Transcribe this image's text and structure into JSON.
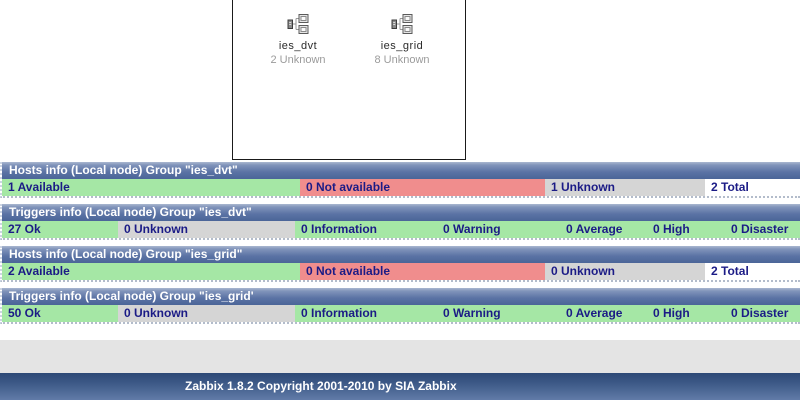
{
  "map": {
    "hosts": [
      {
        "name": "ies_dvt",
        "status": "2 Unknown",
        "icon": "host-group-icon"
      },
      {
        "name": "ies_grid",
        "status": "8 Unknown",
        "icon": "host-group-icon"
      }
    ]
  },
  "widgets": [
    {
      "title": "Hosts info (Local node) Group \"ies_dvt\"",
      "cells": [
        "1 Available",
        "0 Not available",
        "1 Unknown",
        "2 Total"
      ]
    },
    {
      "title": "Triggers info (Local node) Group \"ies_dvt\"",
      "cells": [
        "27 Ok",
        "0 Unknown",
        "0 Information",
        "0 Warning",
        "0 Average",
        "0 High",
        "0 Disaster"
      ]
    },
    {
      "title": "Hosts info (Local node) Group \"ies_grid\"",
      "cells": [
        "2 Available",
        "0 Not available",
        "0 Unknown",
        "2 Total"
      ]
    },
    {
      "title": "Triggers info (Local node) Group \"ies_grid'",
      "cells": [
        "50 Ok",
        "0 Unknown",
        "0 Information",
        "0 Warning",
        "0 Average",
        "0 High",
        "0 Disaster"
      ]
    }
  ],
  "footer": {
    "text": "Zabbix 1.8.2 Copyright 2001-2010 by SIA Zabbix"
  },
  "colors": {
    "header_blue_top": "#aab7d0",
    "header_blue_bottom": "#4b6598",
    "ok_green": "#a5e7a5",
    "problem_pink": "#f08d8d",
    "unknown_gray": "#d5d5d5",
    "total_white": "#ffffff",
    "cell_text_navy": "#1b1b86",
    "footer_blue_top": "#2d4976",
    "footer_blue_bottom": "#617ba8",
    "host_status_gray": "#9b9b9b"
  }
}
